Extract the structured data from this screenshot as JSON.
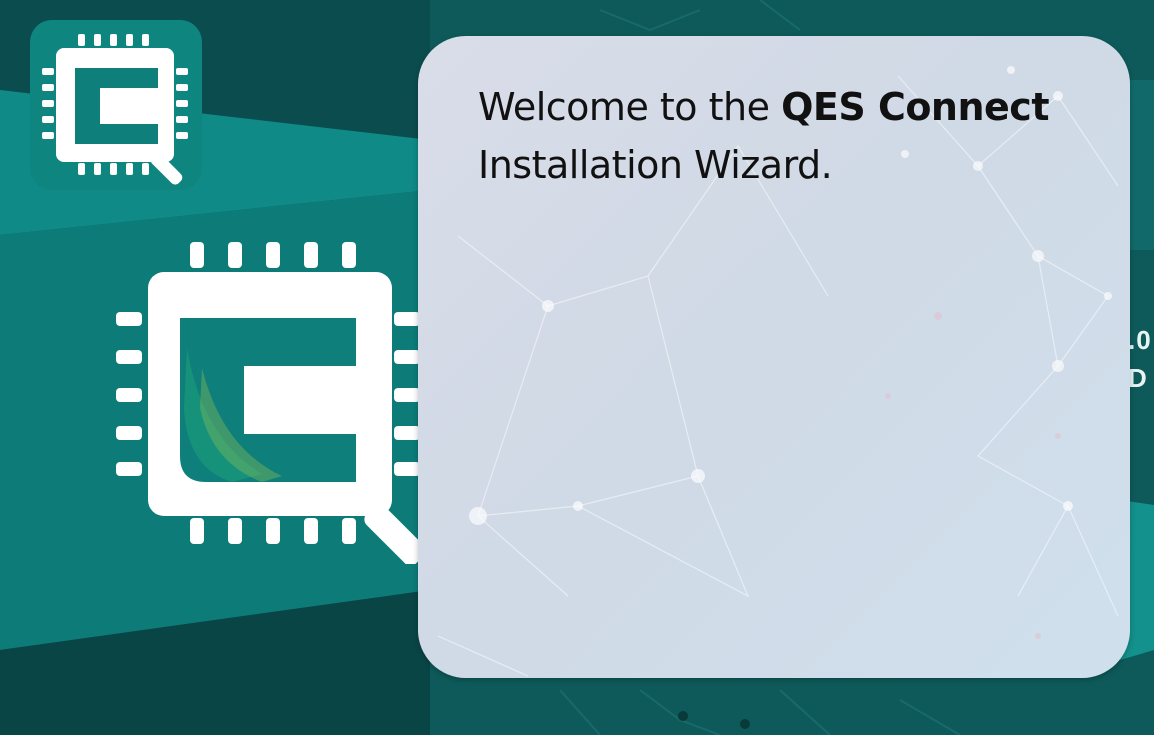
{
  "wizard": {
    "heading_prefix": "Welcome to the ",
    "product_name": "QES Connect",
    "heading_suffix": "Installation Wizard."
  },
  "background": {
    "edge_text_line1": ".0",
    "edge_text_line2": "D"
  },
  "icons": {
    "app_icon": "qes-connect-chip-logo-icon",
    "large_logo": "qes-connect-chip-logo-icon"
  },
  "colors": {
    "teal_dark": "#0b4b4c",
    "teal_mid": "#0f7d7a",
    "teal_light": "#16a19a",
    "panel": "#d6dce8"
  }
}
